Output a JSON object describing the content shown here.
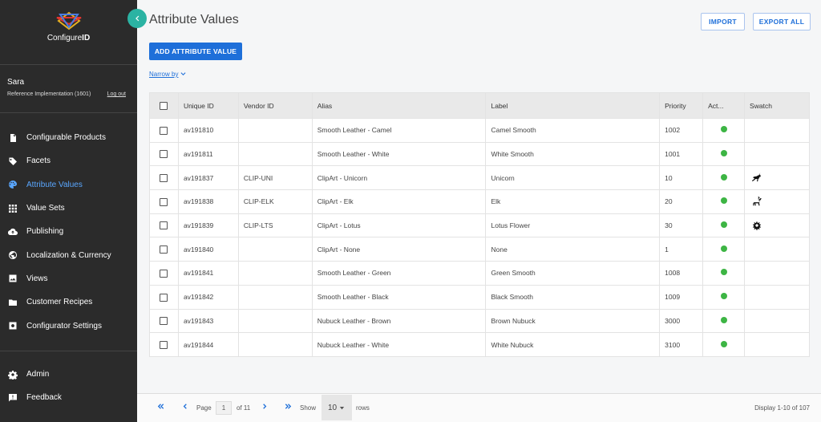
{
  "brand": {
    "name_regular": "Configure",
    "name_bold": "ID"
  },
  "user": {
    "name": "Sara",
    "org": "Reference Implementation (1601)",
    "logout": "Log out"
  },
  "nav_main": [
    {
      "label": "Configurable Products",
      "icon": "document-icon",
      "active": false
    },
    {
      "label": "Facets",
      "icon": "tag-icon",
      "active": false
    },
    {
      "label": "Attribute Values",
      "icon": "palette-icon",
      "active": true
    },
    {
      "label": "Value Sets",
      "icon": "grid-icon",
      "active": false
    },
    {
      "label": "Publishing",
      "icon": "cloud-upload-icon",
      "active": false
    },
    {
      "label": "Localization & Currency",
      "icon": "globe-icon",
      "active": false
    },
    {
      "label": "Views",
      "icon": "image-icon",
      "active": false
    },
    {
      "label": "Customer Recipes",
      "icon": "folder-icon",
      "active": false
    },
    {
      "label": "Configurator Settings",
      "icon": "settings-box-icon",
      "active": false
    }
  ],
  "nav_bottom": [
    {
      "label": "Admin",
      "icon": "gear-icon"
    },
    {
      "label": "Feedback",
      "icon": "feedback-icon"
    }
  ],
  "page": {
    "title": "Attribute Values",
    "import_label": "IMPORT",
    "export_label": "EXPORT ALL",
    "add_label": "ADD ATTRIBUTE VALUE",
    "narrow_label": "Narrow by"
  },
  "table": {
    "columns": [
      "Unique ID",
      "Vendor ID",
      "Alias",
      "Label",
      "Priority",
      "Act...",
      "Swatch"
    ],
    "rows": [
      {
        "id": "av191810",
        "vendor": "",
        "alias": "Smooth Leather - Camel",
        "label": "Camel Smooth",
        "priority": "1002",
        "active": true,
        "swatch": ""
      },
      {
        "id": "av191811",
        "vendor": "",
        "alias": "Smooth Leather - White",
        "label": "White Smooth",
        "priority": "1001",
        "active": true,
        "swatch": ""
      },
      {
        "id": "av191837",
        "vendor": "CLIP-UNI",
        "alias": "ClipArt - Unicorn",
        "label": "Unicorn",
        "priority": "10",
        "active": true,
        "swatch": "unicorn-icon"
      },
      {
        "id": "av191838",
        "vendor": "CLIP-ELK",
        "alias": "ClipArt - Elk",
        "label": "Elk",
        "priority": "20",
        "active": true,
        "swatch": "elk-icon"
      },
      {
        "id": "av191839",
        "vendor": "CLIP-LTS",
        "alias": "ClipArt - Lotus",
        "label": "Lotus Flower",
        "priority": "30",
        "active": true,
        "swatch": "lotus-icon"
      },
      {
        "id": "av191840",
        "vendor": "",
        "alias": "ClipArt - None",
        "label": "None",
        "priority": "1",
        "active": true,
        "swatch": ""
      },
      {
        "id": "av191841",
        "vendor": "",
        "alias": "Smooth Leather - Green",
        "label": "Green Smooth",
        "priority": "1008",
        "active": true,
        "swatch": ""
      },
      {
        "id": "av191842",
        "vendor": "",
        "alias": "Smooth Leather - Black",
        "label": "Black Smooth",
        "priority": "1009",
        "active": true,
        "swatch": ""
      },
      {
        "id": "av191843",
        "vendor": "",
        "alias": "Nubuck Leather - Brown",
        "label": "Brown Nubuck",
        "priority": "3000",
        "active": true,
        "swatch": ""
      },
      {
        "id": "av191844",
        "vendor": "",
        "alias": "Nubuck Leather - White",
        "label": "White Nubuck",
        "priority": "3100",
        "active": true,
        "swatch": ""
      }
    ]
  },
  "pager": {
    "page_label": "Page",
    "current_page": "1",
    "of_label": "of 11",
    "show_label": "Show",
    "rows_value": "10",
    "rows_label": "rows",
    "display_text": "Display 1-10 of 107"
  },
  "colors": {
    "sidebar_bg": "#2b2b2b",
    "accent": "#1e6fd9",
    "active_nav": "#5aa7ff",
    "active_dot": "#3db544",
    "collapse_btn": "#2bb3a3"
  }
}
